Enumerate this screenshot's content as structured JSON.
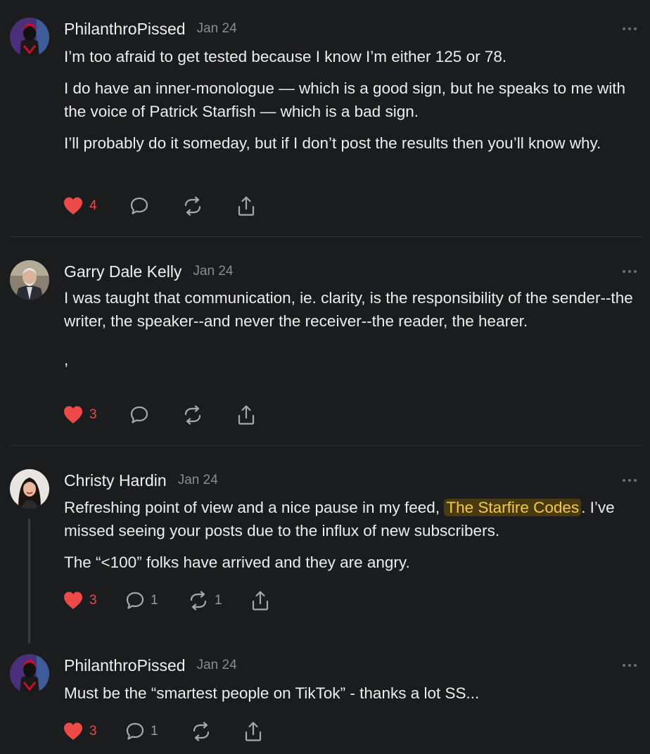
{
  "comments": [
    {
      "author": "PhilanthroPissed",
      "date": "Jan 24",
      "paragraphs": [
        "I’m too afraid to get tested because I know I’m either 125 or 78.",
        "I do have an inner-monologue — which is a good sign, but he speaks to me with the voice of Patrick Starfish — which is a bad sign.",
        "I’ll probably do it someday, but if I don’t post the results then you’ll know why."
      ],
      "likes": "4",
      "replies": "",
      "restacks": ""
    },
    {
      "author": "Garry Dale Kelly",
      "date": "Jan 24",
      "paragraphs": [
        "I was taught that communication, ie. clarity, is the responsibility of the sender--the writer, the speaker--and never the receiver--the reader, the hearer.",
        ","
      ],
      "likes": "3",
      "replies": "",
      "restacks": ""
    },
    {
      "author": "Christy Hardin",
      "date": "Jan 24",
      "p1_before": "Refreshing point of view and a nice pause in my feed, ",
      "p1_mention": "The Starfire Codes",
      "p1_after": ". I’ve missed seeing your posts due to the influx of new subscribers.",
      "p2": "The “<100” folks have arrived and they are angry.",
      "likes": "3",
      "replies": "1",
      "restacks": "1"
    },
    {
      "author": "PhilanthroPissed",
      "date": "Jan 24",
      "paragraphs": [
        "Must be the “smartest people on TikTok” - thanks a lot SS..."
      ],
      "likes": "3",
      "replies": "1",
      "restacks": ""
    }
  ],
  "icons": {
    "like": "heart-icon",
    "reply": "comment-bubble-icon",
    "restack": "restack-icon",
    "share": "share-icon",
    "more": "more-dots-icon"
  },
  "colors": {
    "background": "#1b1c1e",
    "like_red": "#ef4a4a",
    "mention_text": "#f5c84c",
    "mention_bg": "#4a3a12",
    "muted": "#8b8b8d"
  }
}
